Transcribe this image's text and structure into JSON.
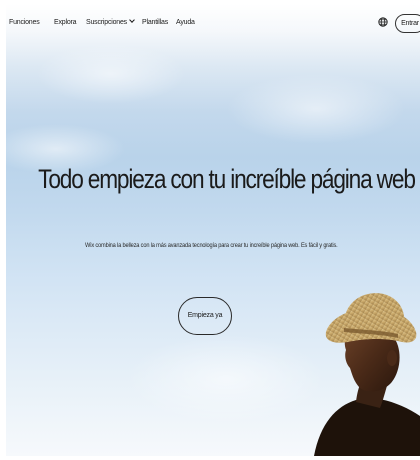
{
  "nav": {
    "items": [
      {
        "label": "Funciones"
      },
      {
        "label": "Explora"
      },
      {
        "label": "Suscripciones"
      },
      {
        "label": "Plantillas"
      },
      {
        "label": "Ayuda"
      }
    ],
    "login_label": "Entrar",
    "language_icon": "globe-icon"
  },
  "hero": {
    "headline": "Todo empieza con tu increíble página web",
    "subline": "Wix combina la belleza con la más avanzada tecnología para crear tu increíble página web. Es fácil y gratis.",
    "cta_label": "Empieza ya"
  },
  "colors": {
    "text": "#1b1b1b",
    "sky_top": "#ffffff",
    "sky_mid": "#b9d3ea",
    "sky_bottom": "#f6f9fc"
  }
}
